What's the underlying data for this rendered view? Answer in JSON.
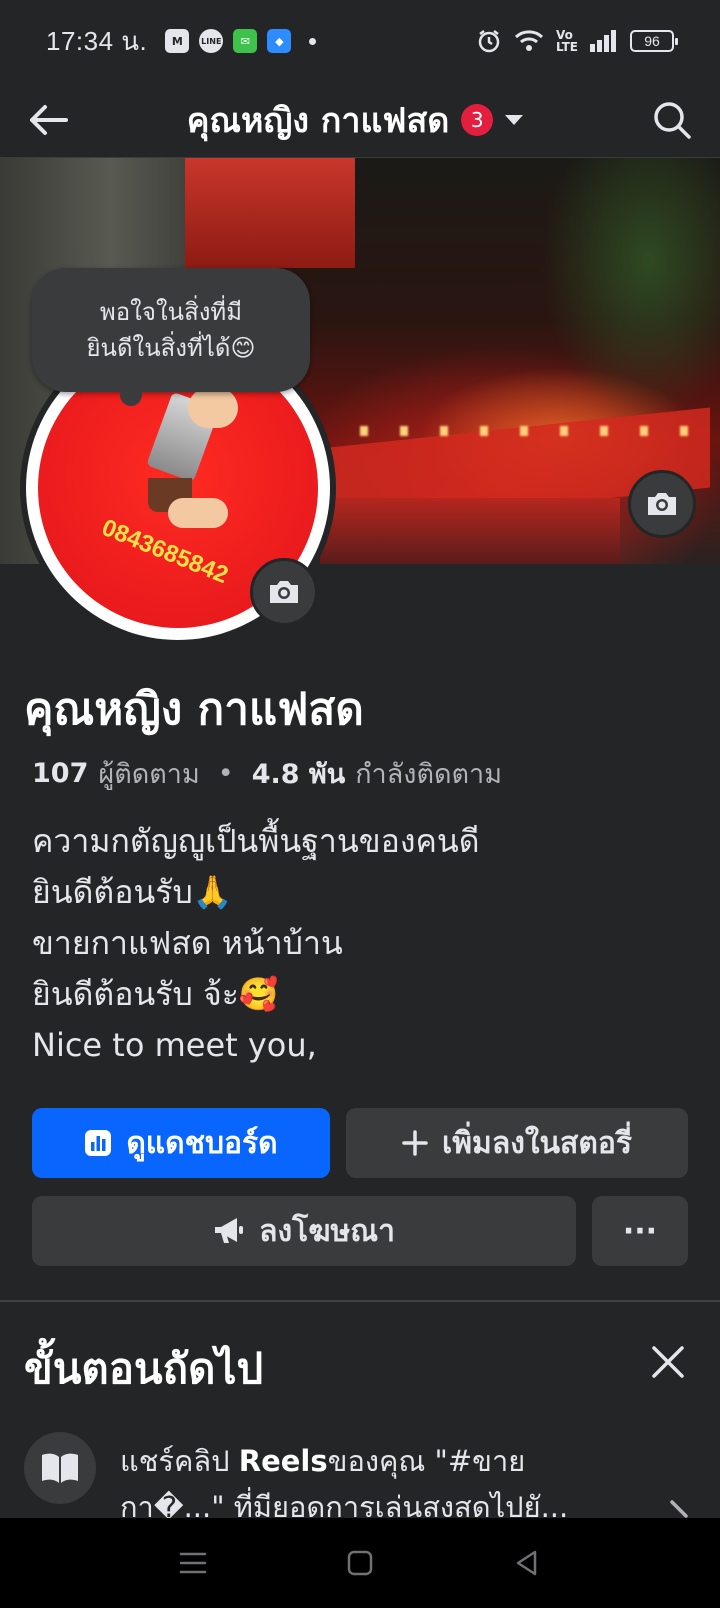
{
  "status_bar": {
    "time": "17:34 น.",
    "battery": "96",
    "apps": [
      "gmail-icon",
      "line-icon",
      "wechat-icon",
      "messenger-icon"
    ]
  },
  "header": {
    "title": "คุณหญิง กาแฟสด",
    "badge_count": "3"
  },
  "avatar": {
    "phone": "0843685842"
  },
  "note": {
    "line1": "พอใจในสิ่งที่มี",
    "line2": "ยินดีในสิ่งที่ได้😊"
  },
  "page": {
    "name": "คุณหญิง กาแฟสด",
    "followers_count": "107",
    "followers_label": "ผู้ติดตาม",
    "following_count": "4.8 พัน",
    "following_label": "กำลังติดตาม",
    "bio": [
      "ความกตัญญูเป็นพื้นฐานของคนดี",
      "ยินดีต้อนรับ🙏",
      "ขายกาแฟสด หน้าบ้าน",
      "ยินดีต้อนรับ จ้ะ🥰",
      "Nice to  meet you,"
    ]
  },
  "buttons": {
    "dashboard": "ดูแดชบอร์ด",
    "add_story": "เพิ่มลงในสตอรี่",
    "advertise": "ลงโฆษณา",
    "more": "···"
  },
  "next_steps": {
    "title": "ขั้นตอนถัดไป",
    "item_prefix": "แชร์คลิป ",
    "item_bold": "Reels",
    "item_line1_rest": "ของคุณ \"#ขาย",
    "item_line2": "กา�...\" ที่มียอดการเล่นสูงสุดไปยั..."
  },
  "colors": {
    "background": "#242526",
    "primary": "#0866ff",
    "badge": "#e41e3f",
    "secondary_button": "#3a3b3c"
  }
}
